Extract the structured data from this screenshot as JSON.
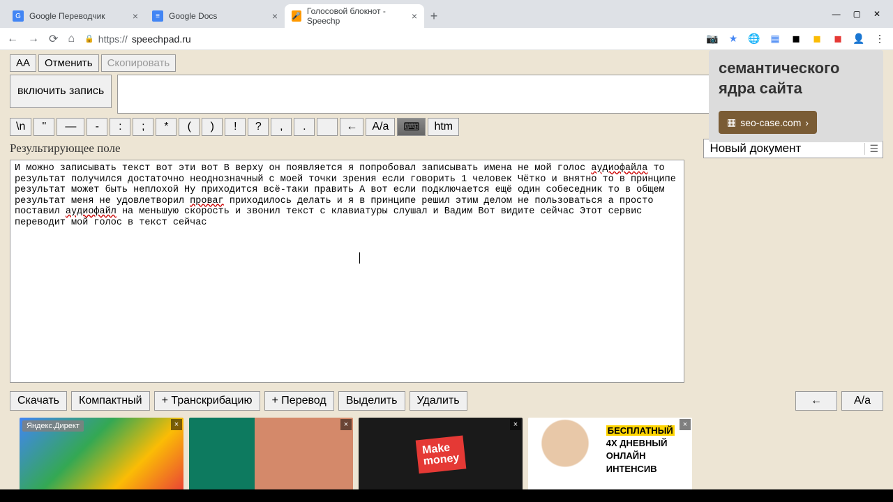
{
  "tabs": [
    {
      "title": "Google Переводчик",
      "active": false
    },
    {
      "title": "Google Docs",
      "active": false
    },
    {
      "title": "Голосовой блокнот - Speechp",
      "active": true
    }
  ],
  "url": {
    "domain": "speechpad.ru",
    "scheme": "https://"
  },
  "top_buttons": {
    "aa": "AA",
    "cancel": "Отменить",
    "copy": "Скопировать"
  },
  "record_btn": "включить запись",
  "punct": [
    "\\n",
    "\"",
    "—",
    "-",
    ":",
    ";",
    "*",
    "(",
    ")",
    "!",
    "?",
    ",",
    ".",
    " ",
    "←",
    "A/a",
    "⌨",
    "htm"
  ],
  "result_label": "Результирующее поле",
  "doc_name": "Новый документ",
  "result_text_parts": {
    "p1": "И можно записывать текст вот эти вот В верху он появляется я попробовал записывать имена не мой голос ",
    "u1": "аудиофайла",
    "p2": " то результат получился достаточно неоднозначный с моей точки зрения если говорить 1 человек Чётко и внятно то в принципе результат может быть неплохой Ну приходится всё-таки править А вот если подключается ещё один собеседник то в общем результат меня не удовлетворил ",
    "u2": "проваг",
    "p3": " приходилось делать и я в принципе решил этим делом не пользоваться а просто поставил ",
    "u3": "аудиофайл",
    "p4": " на меньшую скорость и звонил текст с клавиатуры слушал и Вадим Вот видите сейчас Этот сервис переводит мой голос в текст сейчас"
  },
  "bottom_buttons": {
    "download": "Скачать",
    "compact": "Компактный",
    "transcribe": "+ Транскрибацию",
    "translate": "+ Перевод",
    "select": "Выделить",
    "delete": "Удалить",
    "arrow": "←",
    "case": "A/a"
  },
  "sidebar_ad": {
    "title_partial": "семантического ядра сайта",
    "cta": "seo-case.com",
    "chevron": "›"
  },
  "ads": {
    "label": "Яндекс.Директ",
    "money1": "Make",
    "money2": "money",
    "free": "БЕСПЛАТНЫЙ",
    "line2": "4Х ДНЕВНЫЙ",
    "line3": "ОНЛАЙН",
    "line4": "ИНТЕНСИВ"
  }
}
